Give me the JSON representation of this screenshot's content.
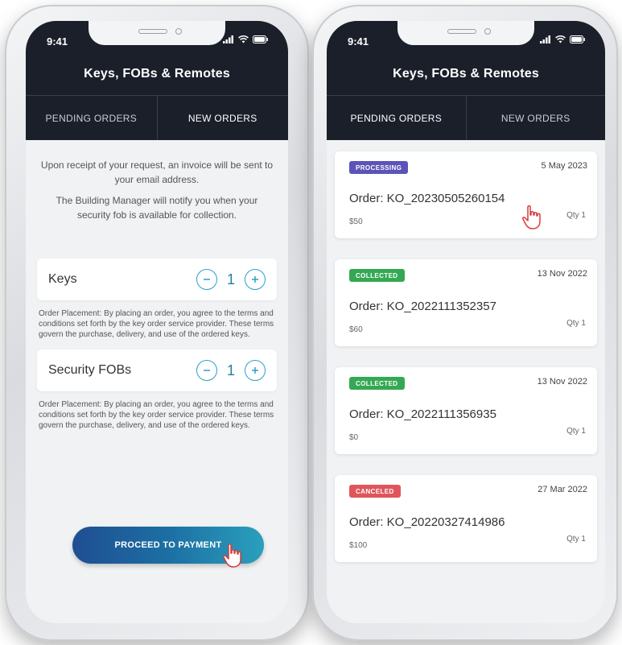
{
  "status_bar": {
    "time": "9:41"
  },
  "app": {
    "title": "Keys, FOBs & Remotes"
  },
  "tabs": [
    {
      "label": "PENDING ORDERS"
    },
    {
      "label": "NEW ORDERS"
    }
  ],
  "new_order": {
    "intro_line1": "Upon receipt of your request, an invoice will be sent to your email address.",
    "intro_line2": "The Building Manager will notify you when your security fob is available for collection.",
    "items": [
      {
        "label": "Keys",
        "quantity": "1"
      },
      {
        "label": "Security FOBs",
        "quantity": "1"
      }
    ],
    "terms": "Order Placement: By placing an order, you agree to the terms and conditions set forth by the key order service provider. These terms govern the purchase, delivery, and use of the ordered keys.",
    "proceed_label": "PROCEED TO PAYMENT"
  },
  "orders": [
    {
      "status": "PROCESSING",
      "status_color": "#5b54b8",
      "date": "5 May 2023",
      "order_id": "Order: KO_20230505260154",
      "price": "$50",
      "qty": "Qty 1"
    },
    {
      "status": "COLLECTED",
      "status_color": "#35a853",
      "date": "13 Nov 2022",
      "order_id": "Order: KO_2022111352357",
      "price": "$60",
      "qty": "Qty 1"
    },
    {
      "status": "COLLECTED",
      "status_color": "#35a853",
      "date": "13 Nov 2022",
      "order_id": "Order: KO_2022111356935",
      "price": "$0",
      "qty": "Qty 1"
    },
    {
      "status": "CANCELED",
      "status_color": "#e0555a",
      "date": "27 Mar 2022",
      "order_id": "Order: KO_20220327414986",
      "price": "$100",
      "qty": "Qty 1"
    }
  ],
  "colors": {
    "header": "#1b1f2a",
    "accent": "#2aa0c8"
  },
  "icons": [
    "minus-circle-icon",
    "plus-circle-icon",
    "signal-icon",
    "wifi-icon",
    "battery-icon",
    "hand-pointer-icon"
  ]
}
